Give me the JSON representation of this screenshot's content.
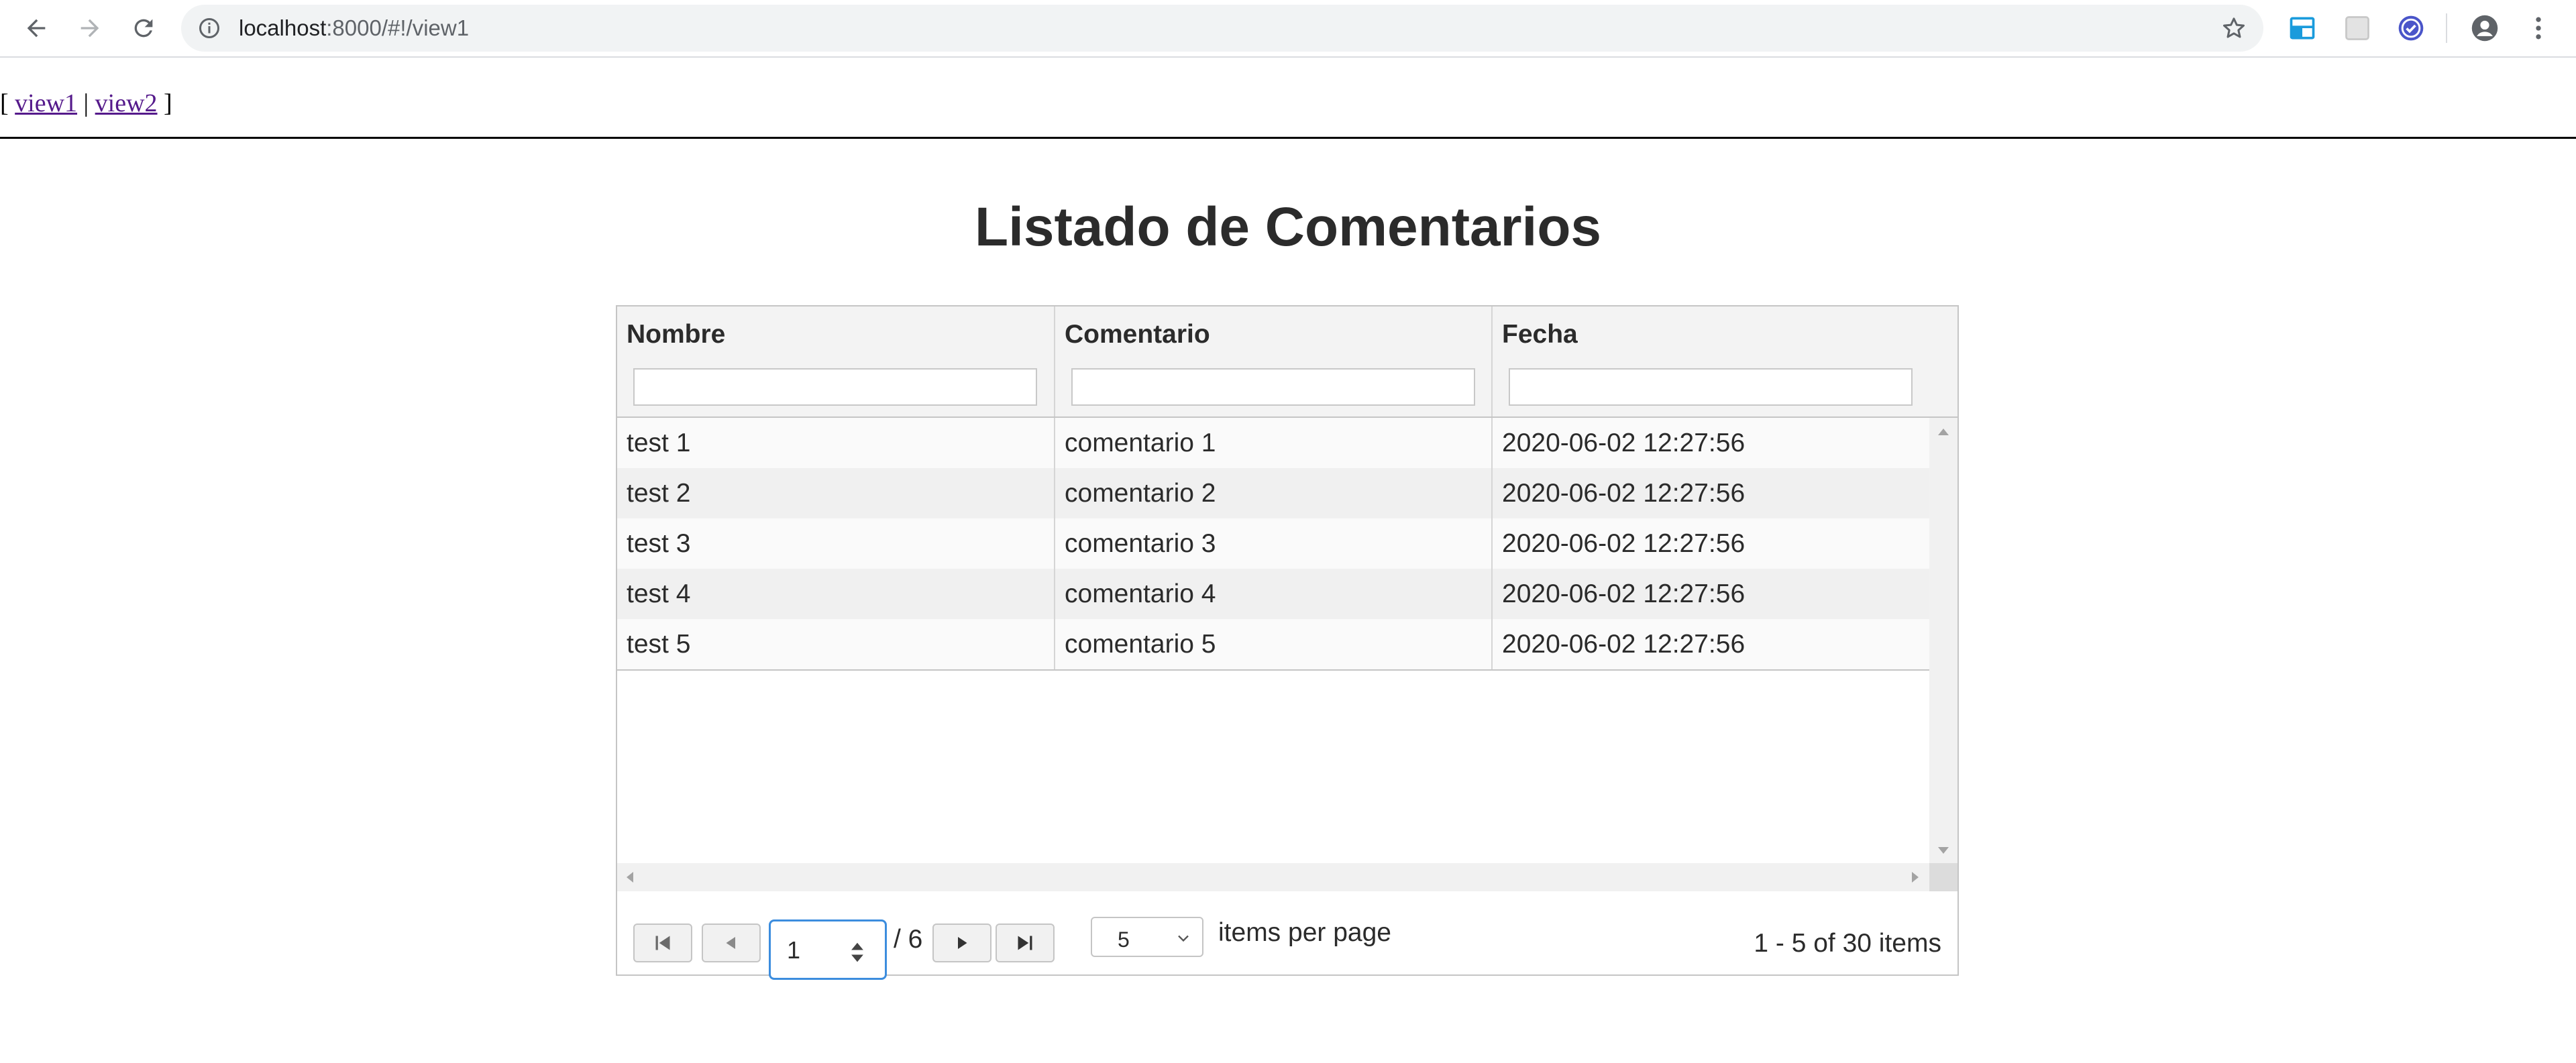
{
  "browser": {
    "url_host": "localhost",
    "url_rest": ":8000/#!/view1",
    "icons": [
      "back-icon",
      "forward-icon",
      "reload-icon",
      "info-icon",
      "star-icon",
      "extension-icon",
      "profile-icon",
      "menu-icon"
    ]
  },
  "nav": {
    "open_bracket": "[",
    "link1": "view1",
    "separator": "|",
    "link2": "view2",
    "close_bracket": "]"
  },
  "page": {
    "title": "Listado de Comentarios"
  },
  "grid": {
    "columns": [
      {
        "label": "Nombre",
        "filter": ""
      },
      {
        "label": "Comentario",
        "filter": ""
      },
      {
        "label": "Fecha",
        "filter": ""
      }
    ],
    "rows": [
      {
        "nombre": "test 1",
        "comentario": "comentario 1",
        "fecha": "2020-06-02 12:27:56"
      },
      {
        "nombre": "test 2",
        "comentario": "comentario 2",
        "fecha": "2020-06-02 12:27:56"
      },
      {
        "nombre": "test 3",
        "comentario": "comentario 3",
        "fecha": "2020-06-02 12:27:56"
      },
      {
        "nombre": "test 4",
        "comentario": "comentario 4",
        "fecha": "2020-06-02 12:27:56"
      },
      {
        "nombre": "test 5",
        "comentario": "comentario 5",
        "fecha": "2020-06-02 12:27:56"
      }
    ]
  },
  "pager": {
    "current_page": "1",
    "total_pages_text": "/ 6",
    "page_size": "5",
    "items_per_page_label": "items per page",
    "summary": "1 - 5 of 30 items"
  },
  "colors": {
    "accent": "#3c8dde",
    "link": "#551a8b"
  }
}
